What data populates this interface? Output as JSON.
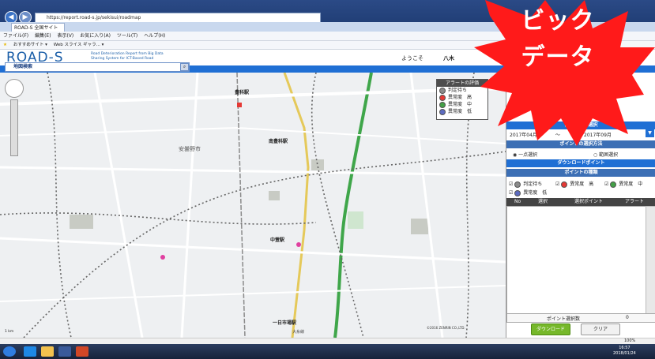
{
  "browser": {
    "address": "https://report.road-s.jp/sekisui/roadmap",
    "tab_title": "ROAD-S 全国サイト",
    "menu": [
      "ファイル(F)",
      "編集(E)",
      "表示(V)",
      "お気に入り(A)",
      "ツール(T)",
      "ヘルプ(H)"
    ],
    "favorites": [
      "おすすめサイト ▾",
      "Web スライス ギャラ... ▾"
    ],
    "zoom": "100%",
    "clock_time": "16:57",
    "clock_date": "2018/01/24"
  },
  "app": {
    "logo": "ROAD-S",
    "logo_sub": "Road Deterioration Report from Big Data Sharing System for ICT-Based Road",
    "welcome": "ようこそ",
    "user": "八木",
    "search_label": "地図検索"
  },
  "map": {
    "places": [
      "豊科駅",
      "南豊科駅",
      "安曇野市",
      "中萱駅",
      "一日市場駅",
      "大糸線"
    ],
    "legend_title": "アラートの評価",
    "legend": [
      {
        "label": "判定待ち",
        "color": "#8a8a8a"
      },
      {
        "label": "異常度　高",
        "color": "#e53935"
      },
      {
        "label": "異常度　中",
        "color": "#43a047"
      },
      {
        "label": "異常度　低",
        "color": "#5c6bc0"
      }
    ],
    "copyright": "©2016 ZENRIN CO.,LTD.",
    "scale": "1 km"
  },
  "panel": {
    "period_header": "計算期間の選択",
    "period_from": "2017年04月",
    "period_sep": "〜",
    "period_to": "2017年09月",
    "method_header": "ポイントの選択方法",
    "method_point": "一点選択",
    "method_range": "範囲選択",
    "download_header": "ダウンロードポイント",
    "type_header": "ポイントの種類",
    "checks": [
      {
        "label": "判定待ち",
        "color": "#8a8a8a"
      },
      {
        "label": "異常度　高",
        "color": "#e53935"
      },
      {
        "label": "異常度　中",
        "color": "#43a047"
      },
      {
        "label": "異常度　低",
        "color": "#5c6bc0"
      }
    ],
    "table_cols": [
      "No",
      "選択",
      "選択ポイント",
      "アラート"
    ],
    "count_label": "ポイント選択数",
    "count_value": "0",
    "download_button": "ダウンロード",
    "clear_button": "クリア"
  },
  "overlay": {
    "line1": "ビック",
    "line2": "データ",
    "color": "#ff1a1a"
  }
}
